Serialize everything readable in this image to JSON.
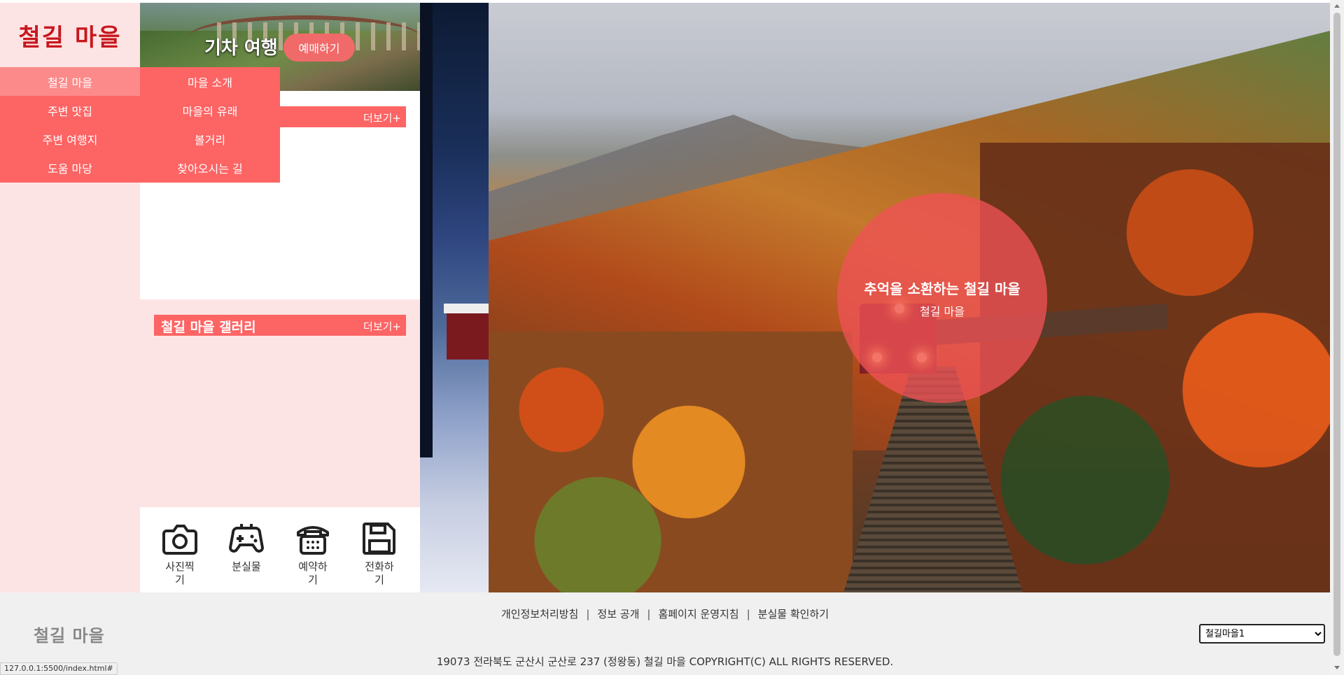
{
  "site": {
    "logo": "철길 마을"
  },
  "nav": {
    "rows": [
      {
        "main": "철길 마을",
        "sub": "마을 소개"
      },
      {
        "main": "주변 맛집",
        "sub": "마을의 유래"
      },
      {
        "main": "주변 여행지",
        "sub": "볼거리"
      },
      {
        "main": "도움 마당",
        "sub": "찾아오시는 길"
      }
    ]
  },
  "banner": {
    "title": "기차 여행",
    "button": "예매하기"
  },
  "notice": {
    "title": "",
    "more": "더보기+"
  },
  "gallery": {
    "title": "철길 마을 갤러리",
    "more": "더보기+"
  },
  "quick_links": [
    {
      "icon": "camera-icon",
      "label": "사진찍기"
    },
    {
      "icon": "gamepad-icon",
      "label": "분실물"
    },
    {
      "icon": "phone-icon",
      "label": "예약하기"
    },
    {
      "icon": "save-icon",
      "label": "전화하기"
    }
  ],
  "hero": {
    "title": "추억을 소환하는 철길 마을",
    "subtitle": "철길 마을"
  },
  "footer": {
    "logo": "철길 마을",
    "links": [
      "개인정보처리방침",
      "정보 공개",
      "홈페이지 운영지침",
      "분실물 확인하기"
    ],
    "address": "19073 전라북도 군산시 군산로 237 (정왕동) 철길 마을 COPYRIGHT(C) ALL RIGHTS RESERVED.",
    "select_value": "철길마을1"
  },
  "status_url": "127.0.0.1:5500/index.html#",
  "colors": {
    "accent": "#fd6464",
    "brand": "#c8161d",
    "panel_pink": "#fde4e4",
    "hero_circle": "#f05256"
  }
}
